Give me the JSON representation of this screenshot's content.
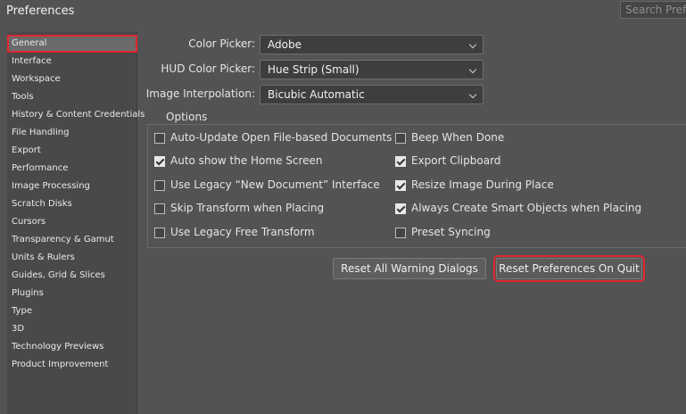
{
  "window": {
    "title": "Preferences"
  },
  "search": {
    "placeholder": "Search Preferences"
  },
  "sidebar": {
    "items": [
      {
        "label": "General",
        "selected": true
      },
      {
        "label": "Interface"
      },
      {
        "label": "Workspace"
      },
      {
        "label": "Tools"
      },
      {
        "label": "History & Content Credentials"
      },
      {
        "label": "File Handling"
      },
      {
        "label": "Export"
      },
      {
        "label": "Performance"
      },
      {
        "label": "Image Processing"
      },
      {
        "label": "Scratch Disks"
      },
      {
        "label": "Cursors"
      },
      {
        "label": "Transparency & Gamut"
      },
      {
        "label": "Units & Rulers"
      },
      {
        "label": "Guides, Grid & Slices"
      },
      {
        "label": "Plugins"
      },
      {
        "label": "Type"
      },
      {
        "label": "3D"
      },
      {
        "label": "Technology Previews"
      },
      {
        "label": "Product Improvement"
      }
    ]
  },
  "general": {
    "color_picker": {
      "label": "Color Picker:",
      "value": "Adobe"
    },
    "hud_color_picker": {
      "label": "HUD Color Picker:",
      "value": "Hue Strip (Small)"
    },
    "image_interpolation": {
      "label": "Image Interpolation:",
      "value": "Bicubic Automatic"
    }
  },
  "options": {
    "title": "Options",
    "left": [
      {
        "label": "Auto-Update Open File-based Documents",
        "checked": false
      },
      {
        "label": "Auto show the Home Screen",
        "checked": true
      },
      {
        "label": "Use Legacy “New Document” Interface",
        "checked": false
      },
      {
        "label": "Skip Transform when Placing",
        "checked": false
      },
      {
        "label": "Use Legacy Free Transform",
        "checked": false
      }
    ],
    "right": [
      {
        "label": "Beep When Done",
        "checked": false
      },
      {
        "label": "Export Clipboard",
        "checked": true
      },
      {
        "label": "Resize Image During Place",
        "checked": true
      },
      {
        "label": "Always Create Smart Objects when Placing",
        "checked": true
      },
      {
        "label": "Preset Syncing",
        "checked": false
      }
    ]
  },
  "buttons": {
    "reset_warnings": "Reset All Warning Dialogs",
    "reset_prefs": "Reset Preferences On Quit"
  },
  "colors": {
    "highlight": "#e0272f",
    "background": "#535353",
    "sidebar": "#494949"
  }
}
